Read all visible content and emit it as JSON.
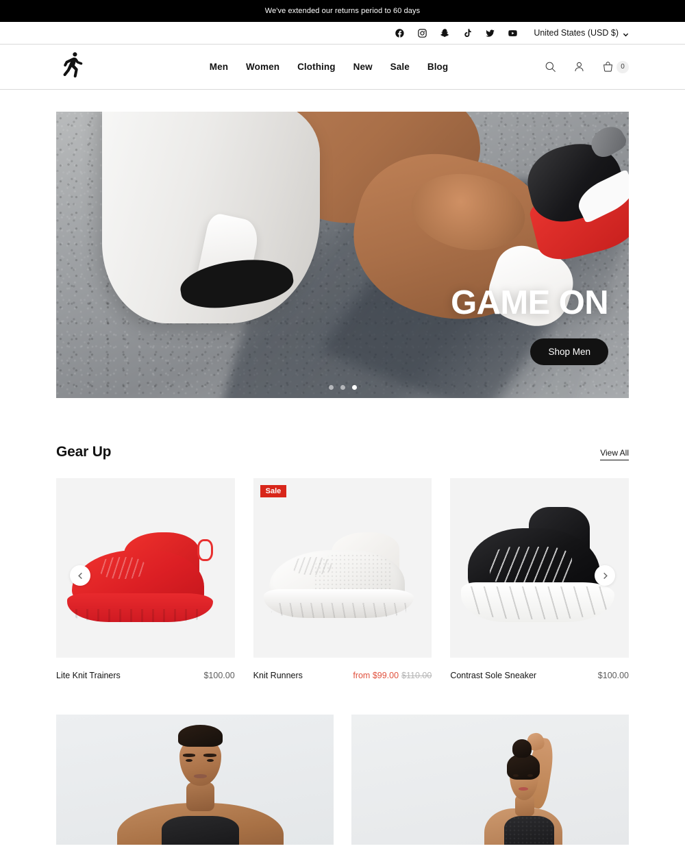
{
  "announcement": {
    "text": "We've extended our returns period to 60 days"
  },
  "utility": {
    "social": [
      {
        "name": "facebook-icon",
        "label": "Facebook"
      },
      {
        "name": "instagram-icon",
        "label": "Instagram"
      },
      {
        "name": "snapchat-icon",
        "label": "Snapchat"
      },
      {
        "name": "tiktok-icon",
        "label": "TikTok"
      },
      {
        "name": "twitter-icon",
        "label": "Twitter"
      },
      {
        "name": "youtube-icon",
        "label": "YouTube"
      }
    ],
    "locale_label": "United States (USD $)"
  },
  "header": {
    "logo_alt": "Running man logo",
    "nav": [
      {
        "label": "Men"
      },
      {
        "label": "Women"
      },
      {
        "label": "Clothing"
      },
      {
        "label": "New"
      },
      {
        "label": "Sale"
      },
      {
        "label": "Blog"
      }
    ],
    "search_label": "Search",
    "account_label": "Account",
    "cart_count": "0"
  },
  "hero": {
    "title": "GAME ON",
    "cta_label": "Shop Men",
    "slide_count": 3,
    "active_slide": 3,
    "image_alt": "Athlete in white kit sitting on asphalt wearing red and black sneakers"
  },
  "gear_up": {
    "title": "Gear Up",
    "view_all_label": "View All",
    "prev_label": "Previous",
    "next_label": "Next",
    "products": [
      {
        "name": "Lite Knit Trainers",
        "price": "$100.00",
        "compare_at": "",
        "on_sale": false,
        "badge": "",
        "image_alt": "Red knit running trainer"
      },
      {
        "name": "Knit Runners",
        "price": "from $99.00",
        "compare_at": "$110.00",
        "on_sale": true,
        "badge": "Sale",
        "image_alt": "White knit running shoe"
      },
      {
        "name": "Contrast Sole Sneaker",
        "price": "$100.00",
        "compare_at": "",
        "on_sale": false,
        "badge": "",
        "image_alt": "Black high-top sneaker with white contrast sole"
      }
    ]
  },
  "collage": {
    "tiles": [
      {
        "image_alt": "Male model in black tank top"
      },
      {
        "image_alt": "Female model in black sports top"
      }
    ]
  },
  "colors": {
    "accent_sale": "#d8261a",
    "sale_price": "#e0513d",
    "ink": "#121212",
    "muted": "#5c5c5c",
    "card_bg": "#f3f3f3"
  }
}
